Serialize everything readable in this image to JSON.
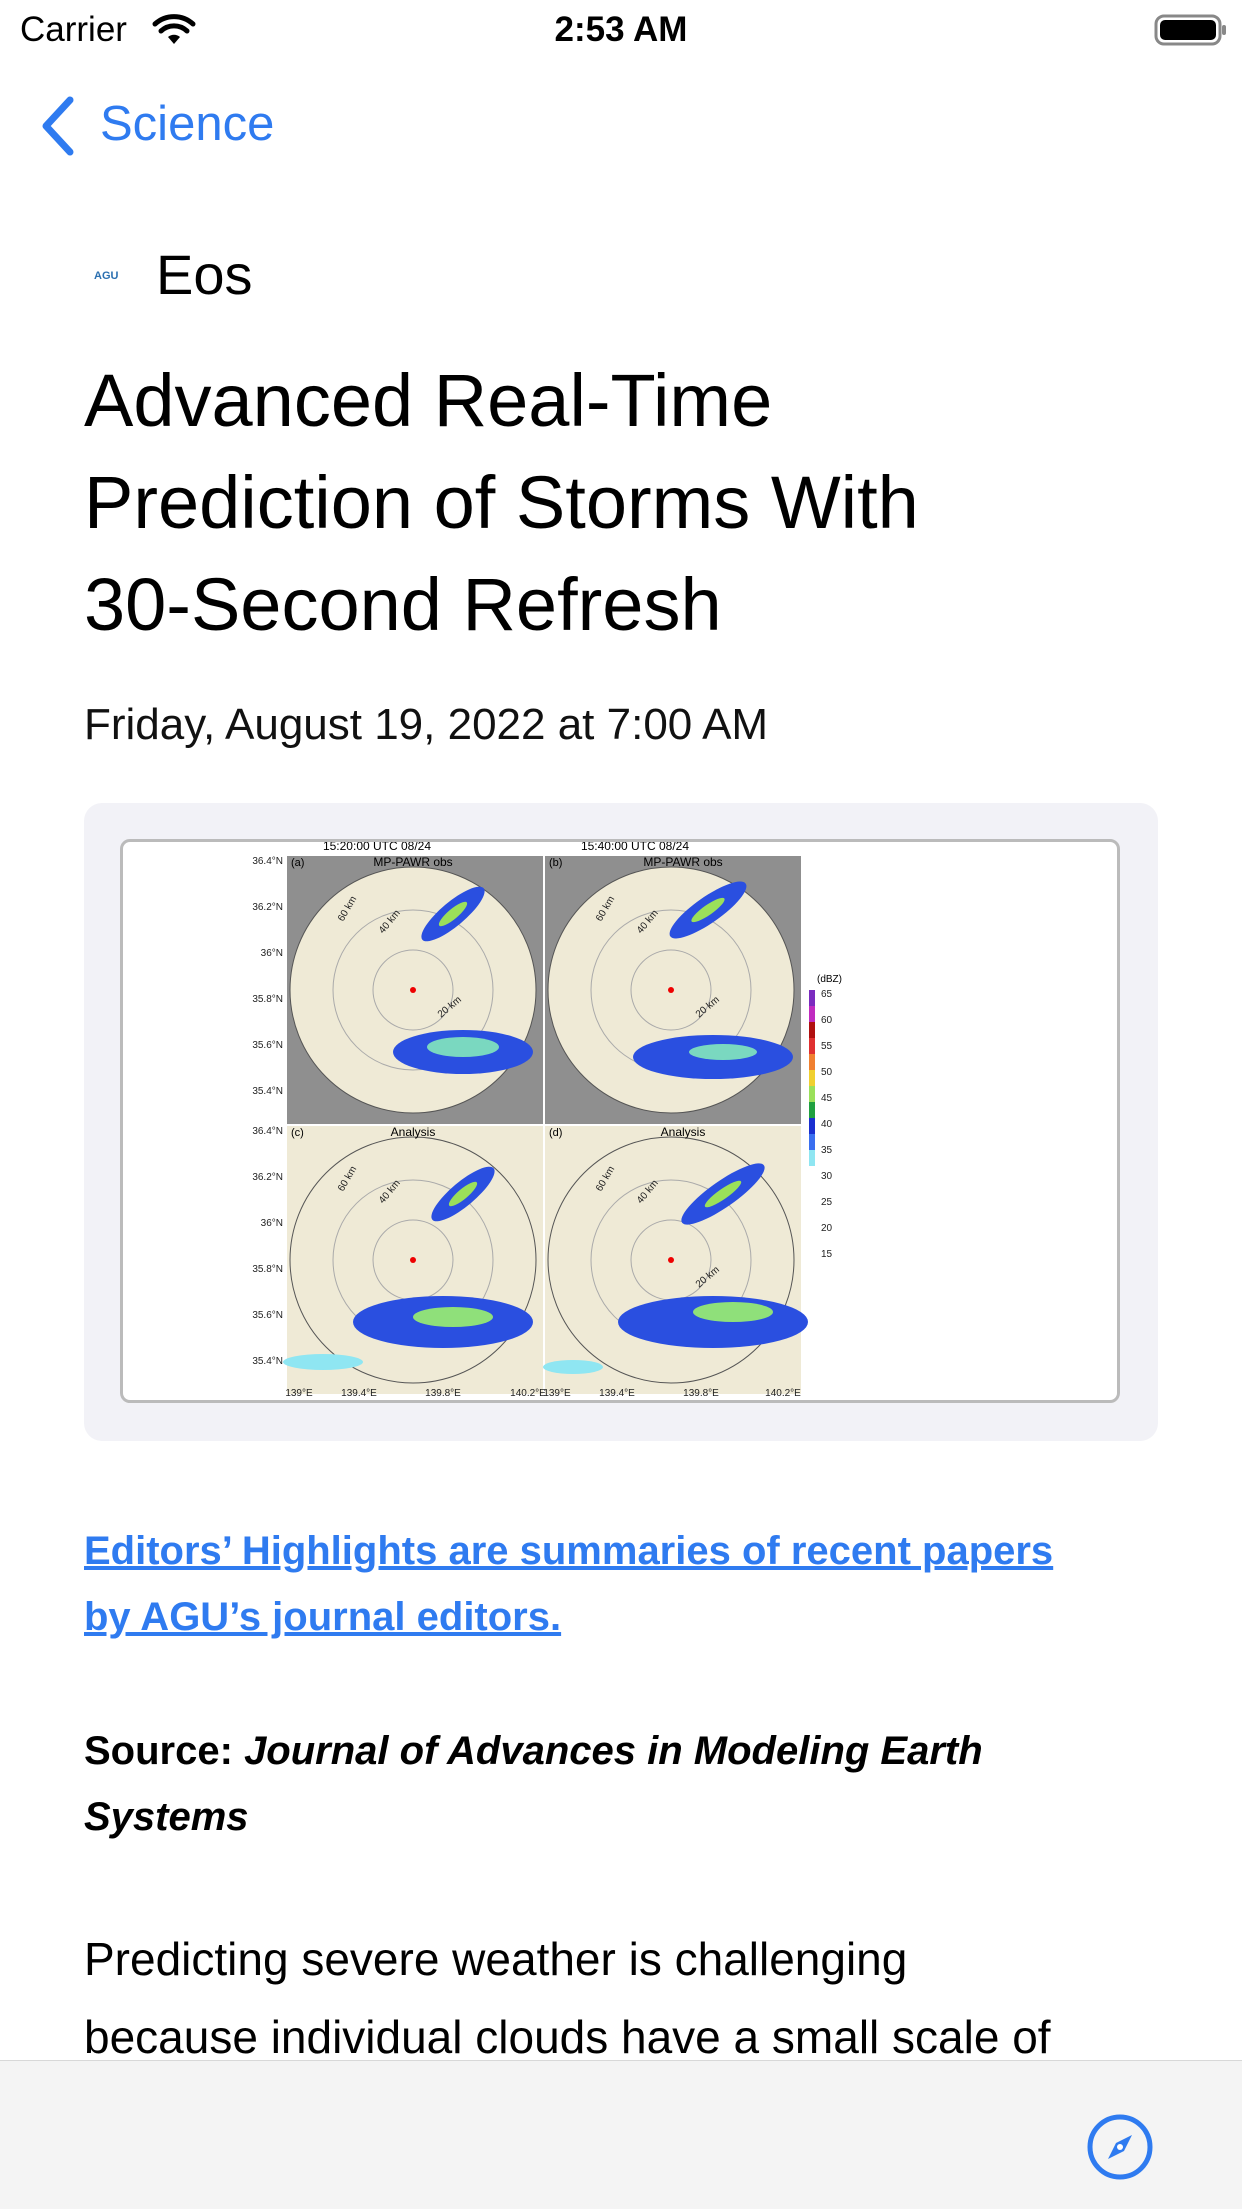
{
  "status_bar": {
    "carrier": "Carrier",
    "time": "2:53 AM"
  },
  "nav": {
    "back_label": "Science"
  },
  "source": {
    "logo_text": "AGU",
    "name": "Eos"
  },
  "article": {
    "title_lines": [
      "Advanced Real-Time",
      "Prediction of Storms With",
      "30-Second Refresh"
    ],
    "date": "Friday, August 19, 2022 at 7:00 AM",
    "figure": {
      "panel_titles": [
        "15:20:00 UTC 08/24",
        "15:40:00 UTC 08/24"
      ],
      "panel_labels": [
        "(a)",
        "(b)",
        "(c)",
        "(d)"
      ],
      "panel_names": [
        "MP-PAWR obs",
        "MP-PAWR obs",
        "Analysis",
        "Analysis"
      ],
      "lat_ticks": [
        "36.4°N",
        "36.2°N",
        "36°N",
        "35.8°N",
        "35.6°N",
        "35.4°N"
      ],
      "lon_ticks": [
        "139°E",
        "139.4°E",
        "139.8°E",
        "140.2°E"
      ],
      "colorbar_unit": "(dBZ)",
      "colorbar_ticks": [
        "65",
        "60",
        "55",
        "50",
        "45",
        "40",
        "35",
        "30",
        "25",
        "20",
        "15"
      ],
      "range_labels": [
        "60 km",
        "40 km",
        "20 km"
      ]
    },
    "highlight_link_lines": [
      "Editors’ Highlights are summaries of recent papers",
      "by AGU’s journal editors."
    ],
    "source_label": "Source:",
    "source_journal_line1": "Journal of Advances in Modeling Earth",
    "source_journal_line2": "Systems",
    "body_lines": [
      "Predicting severe weather is challenging",
      "because individual clouds have a small scale of"
    ]
  },
  "colors": {
    "accent": "#2f7bf0",
    "figure_bg": "#f2f2f7",
    "toolbar_bg": "#f4f4f4"
  },
  "toolbar": {
    "icon": "compass-icon"
  }
}
